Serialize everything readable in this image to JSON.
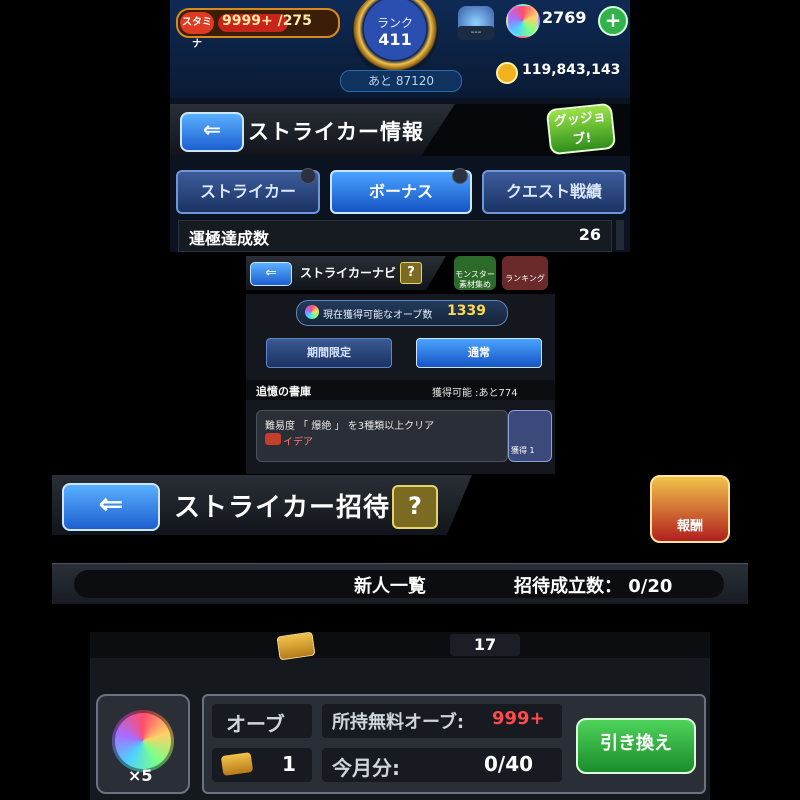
{
  "panel1": {
    "stamina_icon": "スタミナ",
    "stamina_value": "9999+",
    "stamina_max": "/275",
    "rank_label": "ランク",
    "rank_value": "411",
    "rank_next": "あと 87120",
    "item_dash": "---",
    "orbs": "2769",
    "coins": "119,843,143",
    "header_title": "ストライカー情報",
    "good_job": "グッジョブ!",
    "tabs": [
      {
        "label": "ストライカー"
      },
      {
        "label": "ボーナス"
      },
      {
        "label": "クエスト戦績"
      }
    ],
    "luck_label": "運極達成数",
    "luck_value": "26"
  },
  "panel2": {
    "title": "ストライカーナビ",
    "help": "?",
    "monster_label": "モンスター素材集め",
    "ranking_label": "ランキング",
    "orb_available_label": "現在獲得可能なオーブ数",
    "orb_available_value": "1339",
    "tabs": [
      {
        "label": "期間限定"
      },
      {
        "label": "通常"
      }
    ],
    "memory_title": "追憶の書庫",
    "memory_remaining": "獲得可能 :あと774",
    "mission_text": "難易度 「 爆絶 」 を3種類以上クリア",
    "mission_sub": "イデア",
    "reward_label": "獲得",
    "reward_count": "1"
  },
  "panel3": {
    "title": "ストライカー招待",
    "help": "?",
    "reward_badge": "報酬",
    "newcomer_list": "新人一覧",
    "invite_label": "招待成立数：",
    "invite_count": "0/20"
  },
  "panel4": {
    "ticket_count": "17",
    "orb_label": "オーブ",
    "free_orb_label": "所持無料オーブ:",
    "free_orb_value": "999+",
    "x5": "×5",
    "ticket_small_count": "1",
    "month_label": "今月分:",
    "month_value": "0/40",
    "exchange_button": "引き換え"
  },
  "colors": {
    "accent_blue": "#1c5fd0",
    "accent_green": "#2fb34a",
    "warning_red": "#ff4a4a"
  }
}
